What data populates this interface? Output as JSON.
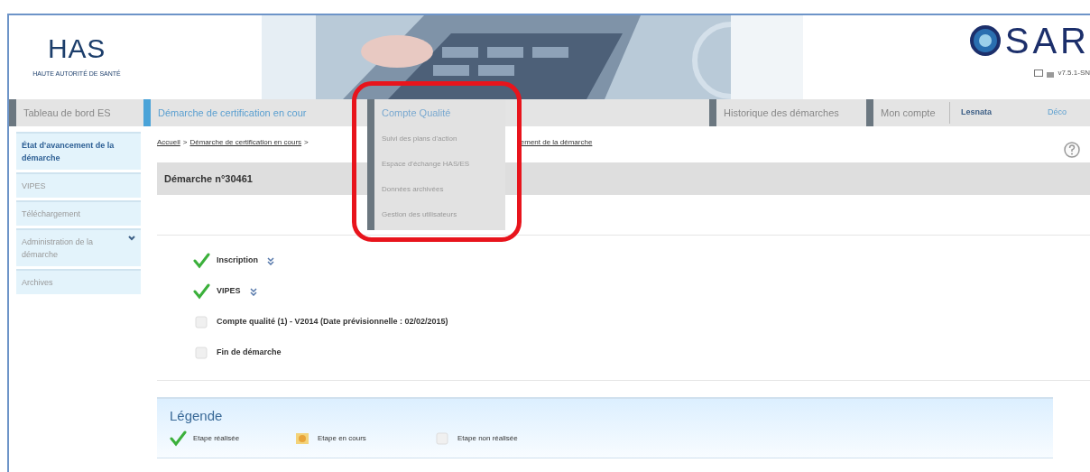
{
  "header": {
    "logo": {
      "text": "HAS",
      "subtitle": "HAUTE AUTORITÉ DE SANTÉ"
    },
    "app_logo": "SAR",
    "version": "v7.5.1-SN"
  },
  "nav": {
    "items": [
      {
        "label": "Tableau de bord ES",
        "selected": false,
        "open": false
      },
      {
        "label": "Démarche de certification en cour",
        "selected": true,
        "open": false
      },
      {
        "label": "Compte Qualité",
        "selected": false,
        "open": true
      },
      {
        "label": "Historique des démarches",
        "selected": false,
        "open": false
      },
      {
        "label": "Mon compte",
        "selected": false,
        "open": false
      }
    ],
    "user": "Lesnata",
    "logout": "Déco"
  },
  "dropdown": {
    "items": [
      "Suivi des plans d'action",
      "Espace d'échange HAS/ES",
      "Données archivées",
      "Gestion des utilisateurs"
    ]
  },
  "sidebar": {
    "items": [
      {
        "label": "État d'avancement de la démarche",
        "selected": true,
        "expandable": false
      },
      {
        "label": "VIPES",
        "selected": false,
        "expandable": false
      },
      {
        "label": "Téléchargement",
        "selected": false,
        "expandable": false
      },
      {
        "label": "Administration de la démarche",
        "selected": false,
        "expandable": true
      },
      {
        "label": "Archives",
        "selected": false,
        "expandable": false
      }
    ]
  },
  "breadcrumb": {
    "items": [
      "Accueil",
      "Démarche de certification en cours"
    ],
    "separators": [
      ">",
      ">"
    ],
    "partial": "ement de la démarche"
  },
  "title": "Démarche n°30461",
  "steps": [
    {
      "label": "Inscription",
      "completed": true,
      "expandable": true
    },
    {
      "label": "VIPES",
      "completed": true,
      "expandable": true
    },
    {
      "label": "Compte qualité (1) - V2014 (Date prévisionnelle : 02/02/2015)",
      "completed": false,
      "expandable": false
    },
    {
      "label": "Fin de démarche",
      "completed": false,
      "expandable": false
    }
  ],
  "legend": {
    "title": "Légende",
    "items": [
      {
        "kind": "done",
        "label": "Etape réalisée"
      },
      {
        "kind": "in_progress",
        "label": "Etape en cours"
      },
      {
        "kind": "pending",
        "label": "Etape non réalisée"
      }
    ]
  }
}
